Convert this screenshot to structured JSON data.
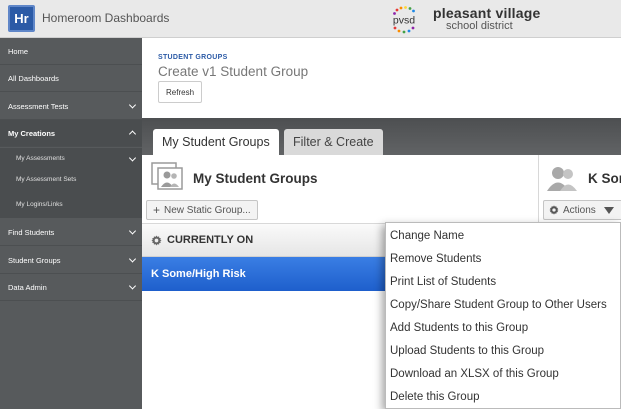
{
  "app": {
    "logo_text": "Hr",
    "title": "Homeroom Dashboards"
  },
  "district": {
    "logo_text": "pvsd",
    "name": "pleasant village",
    "subtitle": "school district"
  },
  "sidebar": {
    "items": [
      {
        "label": "Home"
      },
      {
        "label": "All Dashboards"
      },
      {
        "label": "Assessment Tests"
      },
      {
        "label": "My Creations"
      },
      {
        "label": "Find Students"
      },
      {
        "label": "Student Groups"
      },
      {
        "label": "Data Admin"
      }
    ],
    "subitems": [
      {
        "label": "My Assessments"
      },
      {
        "label": "My Assessment Sets"
      },
      {
        "label": "My Logins/Links"
      }
    ]
  },
  "header": {
    "breadcrumb": "STUDENT GROUPS",
    "title": "Create v1 Student Group",
    "refresh_label": "Refresh"
  },
  "tabs": [
    {
      "label": "My Student Groups"
    },
    {
      "label": "Filter & Create"
    }
  ],
  "left_panel": {
    "heading": "My Student Groups",
    "new_group_label": "New Static Group...",
    "section_title": "CURRENTLY ON",
    "selected_group": "K Some/High Risk"
  },
  "right_panel": {
    "heading": "K Som",
    "actions_label": "Actions"
  },
  "context_menu": {
    "items": [
      "Change Name",
      "Remove Students",
      "Print List of Students",
      "Copy/Share Student Group to Other Users",
      "Add Students to this Group",
      "Upload Students to this Group",
      "Download an XLSX of this Group",
      "Delete this Group"
    ]
  },
  "colors": {
    "brand_blue": "#2b5aa6",
    "selected_row": "#2a6fd8",
    "sidebar_bg": "#575a5c"
  }
}
